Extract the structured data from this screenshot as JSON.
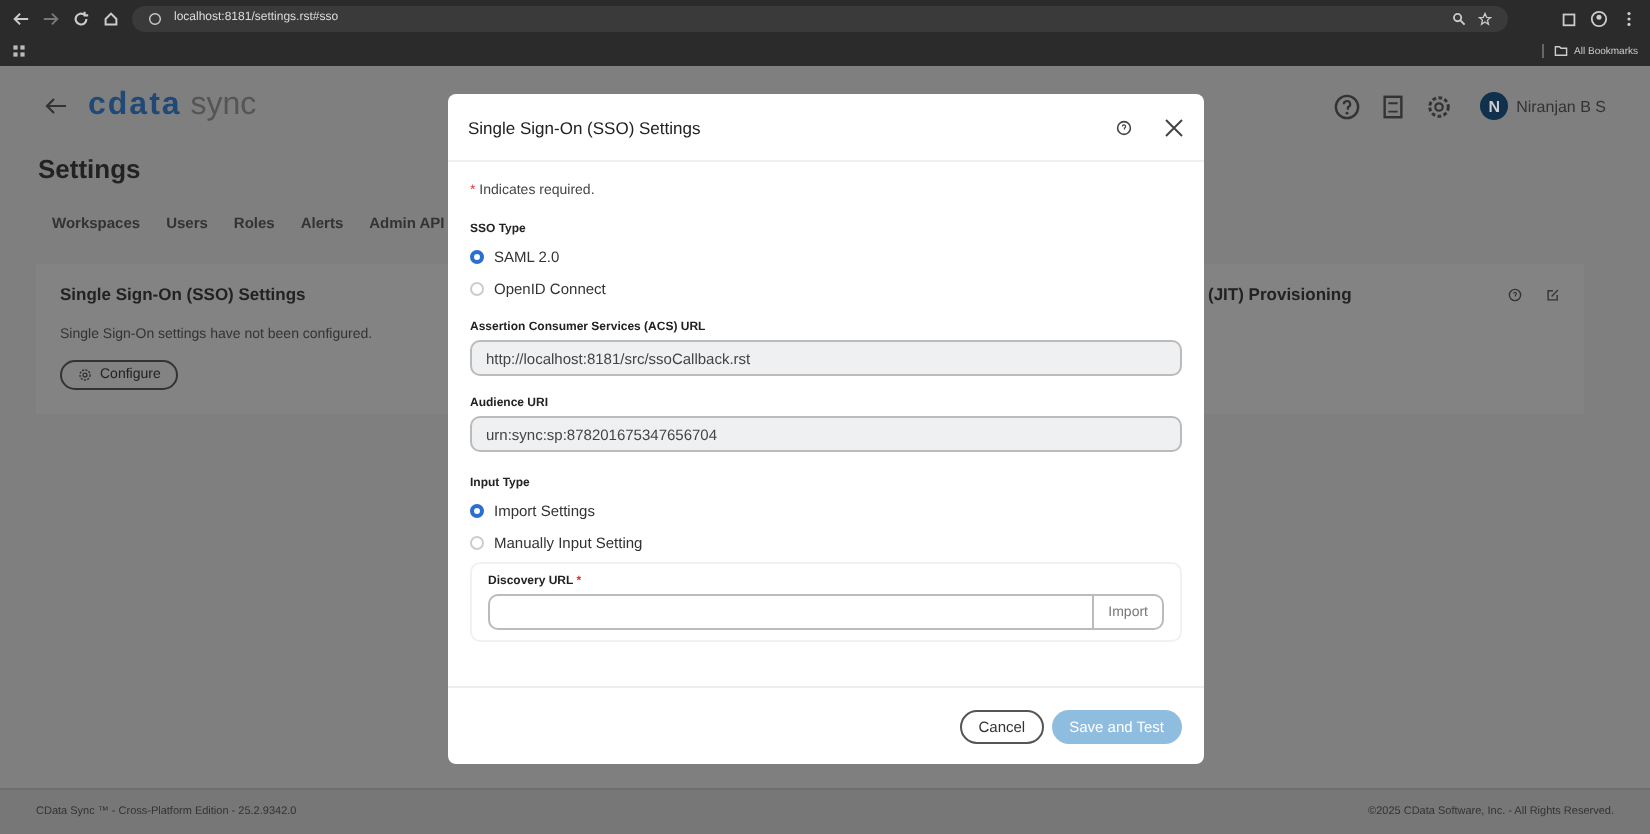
{
  "browser": {
    "url": "localhost:8181/settings.rst#sso",
    "bookmarks_label": "All Bookmarks"
  },
  "header": {
    "logo_brand": "cdata",
    "logo_product": "sync",
    "user": {
      "initial": "N",
      "name": "Niranjan B S"
    }
  },
  "page_title": "Settings",
  "tabs": [
    "Workspaces",
    "Users",
    "Roles",
    "Alerts",
    "Admin API"
  ],
  "cards": [
    {
      "title": "Single Sign-On (SSO) Settings",
      "text": "Single Sign-On settings have not been configured.",
      "button": "Configure"
    },
    {
      "title": "(JIT) Provisioning"
    }
  ],
  "modal": {
    "title": "Single Sign-On (SSO) Settings",
    "required_mark": "*",
    "required_note": "Indicates required.",
    "sso_type": {
      "label": "SSO Type",
      "options": [
        {
          "label": "SAML 2.0",
          "selected": true
        },
        {
          "label": "OpenID Connect",
          "selected": false
        }
      ]
    },
    "fields": [
      {
        "label": "Assertion Consumer Services (ACS) URL",
        "value": "http://localhost:8181/src/ssoCallback.rst"
      },
      {
        "label": "Audience URI",
        "value": "urn:sync:sp:878201675347656704"
      }
    ],
    "input_type": {
      "label": "Input Type",
      "options": [
        {
          "label": "Import Settings",
          "selected": true
        },
        {
          "label": "Manually Input Setting",
          "selected": false
        }
      ]
    },
    "discovery": {
      "label": "Discovery URL",
      "required_mark": "*",
      "button": "Import"
    },
    "buttons": {
      "cancel": "Cancel",
      "save": "Save and Test",
      "save_disabled": true
    }
  },
  "footer": {
    "left": "CData Sync ™ - Cross-Platform Edition - 25.2.9342.0",
    "right": "©2025 CData Software, Inc. - All Rights Reserved."
  }
}
